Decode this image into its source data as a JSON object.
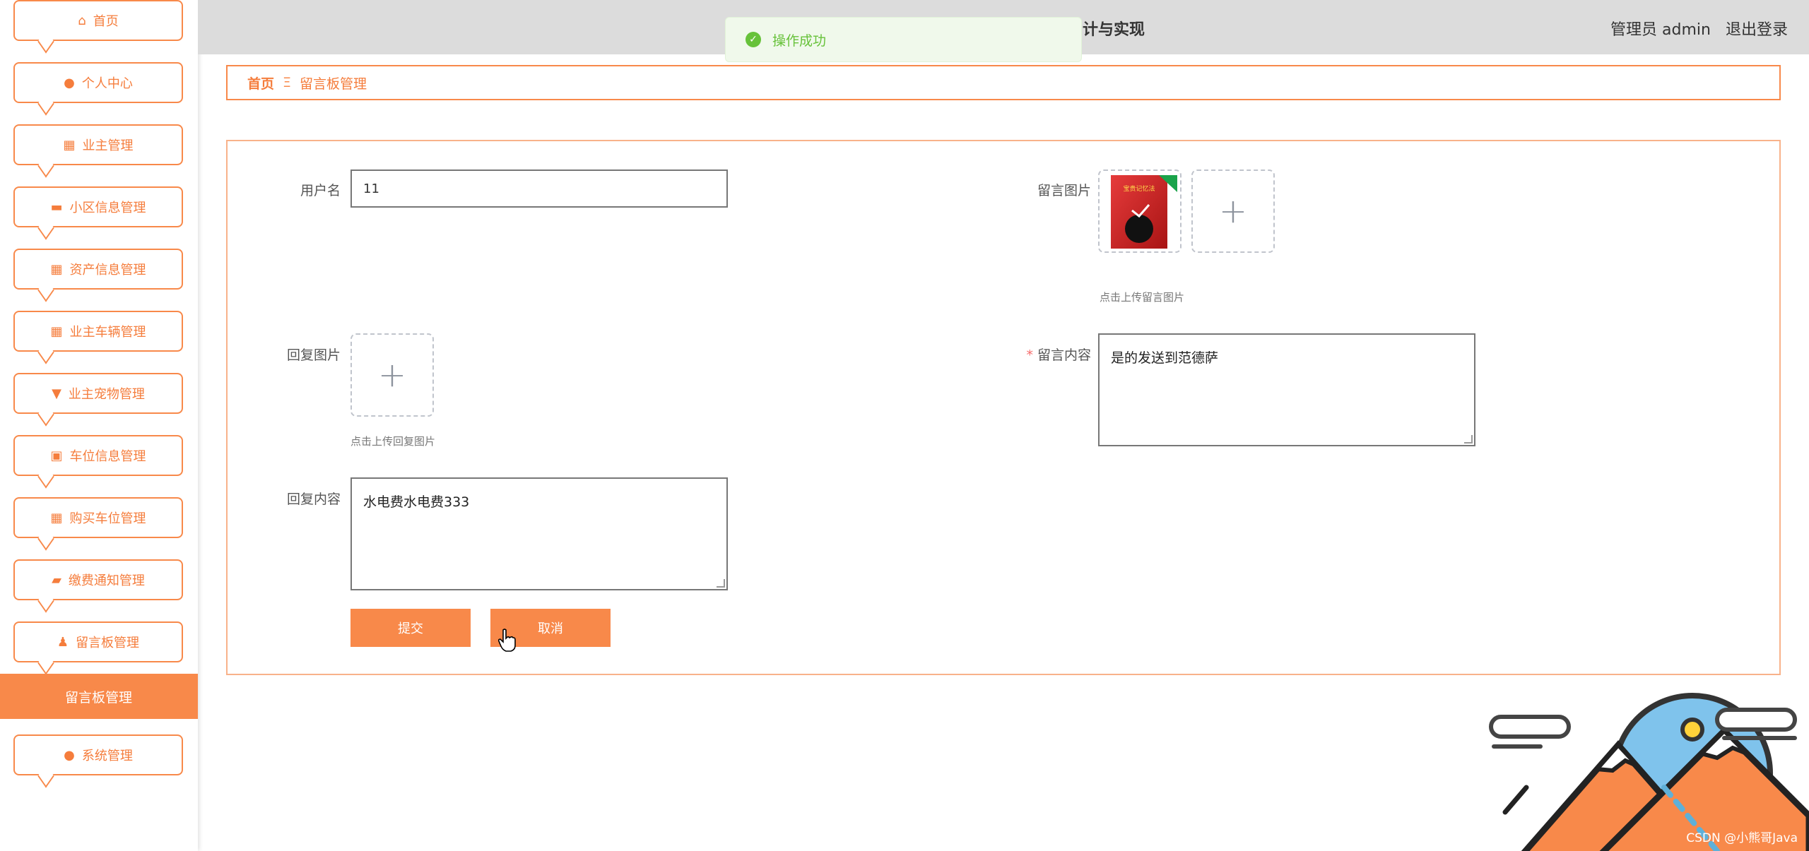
{
  "header": {
    "system_title": "计与实现",
    "user_label": "管理员 admin",
    "logout_label": "退出登录"
  },
  "toast": {
    "message": "操作成功"
  },
  "sidebar": {
    "items": [
      {
        "label": "首页",
        "icon": "home-icon"
      },
      {
        "label": "个人中心",
        "icon": "user-icon"
      },
      {
        "label": "业主管理",
        "icon": "grid-icon"
      },
      {
        "label": "小区信息管理",
        "icon": "briefcase-icon"
      },
      {
        "label": "资产信息管理",
        "icon": "grid-icon"
      },
      {
        "label": "业主车辆管理",
        "icon": "grid-icon"
      },
      {
        "label": "业主宠物管理",
        "icon": "tag-icon"
      },
      {
        "label": "车位信息管理",
        "icon": "document-icon"
      },
      {
        "label": "购买车位管理",
        "icon": "grid-icon"
      },
      {
        "label": "缴费通知管理",
        "icon": "wallet-icon"
      },
      {
        "label": "留言板管理",
        "icon": "stamp-icon"
      },
      {
        "label": "系统管理",
        "icon": "user-icon"
      }
    ],
    "active_sub": "留言板管理"
  },
  "breadcrumb": {
    "home": "首页",
    "separator": "Ξ",
    "current": "留言板管理"
  },
  "form": {
    "username_label": "用户名",
    "username_value": "11",
    "msg_image_label": "留言图片",
    "msg_image_hint": "点击上传留言图片",
    "reply_image_label": "回复图片",
    "reply_image_hint": "点击上传回复图片",
    "msg_content_label": "留言内容",
    "msg_content_value": "是的发送到范德萨",
    "reply_content_label": "回复内容",
    "reply_content_value": "水电费水电费333",
    "submit_label": "提交",
    "cancel_label": "取消",
    "thumb_title": "宝贵记忆法"
  },
  "watermark": "CSDN @小熊哥Java",
  "colors": {
    "accent": "#f8894a",
    "success": "#67c23a",
    "header_bg": "#dcdcdc"
  }
}
